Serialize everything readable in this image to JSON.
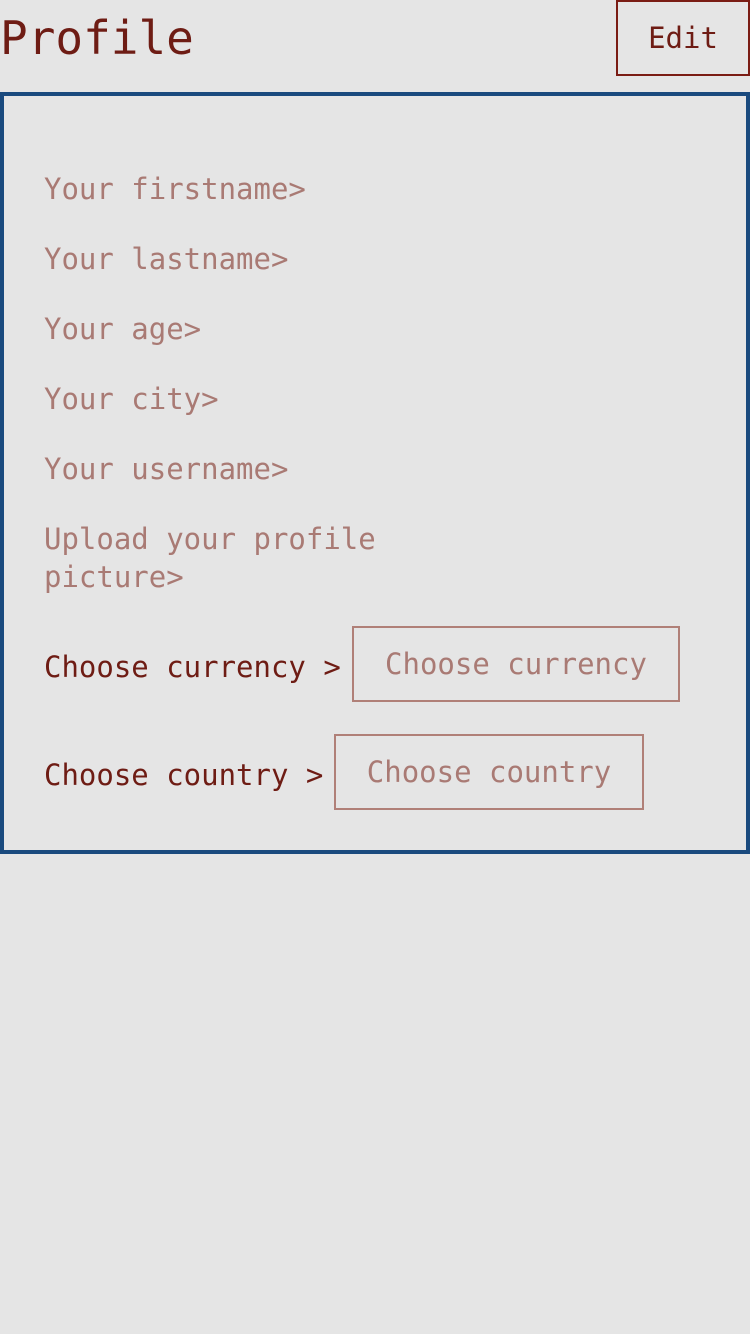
{
  "header": {
    "title": "Profile",
    "edit_label": "Edit"
  },
  "form": {
    "firstname": "Your firstname>",
    "lastname": "Your lastname>",
    "age": "Your age>",
    "city": "Your city>",
    "username": "Your username>",
    "profile_picture": "Upload your profile picture>",
    "currency_label": "Choose currency >",
    "currency_select": "Choose currency",
    "country_label": "Choose country >",
    "country_select": "Choose country"
  },
  "colors": {
    "title": "#6e1c14",
    "link": "#a97a74",
    "card_border": "#1a4a7e",
    "background": "#e5e5e5"
  }
}
